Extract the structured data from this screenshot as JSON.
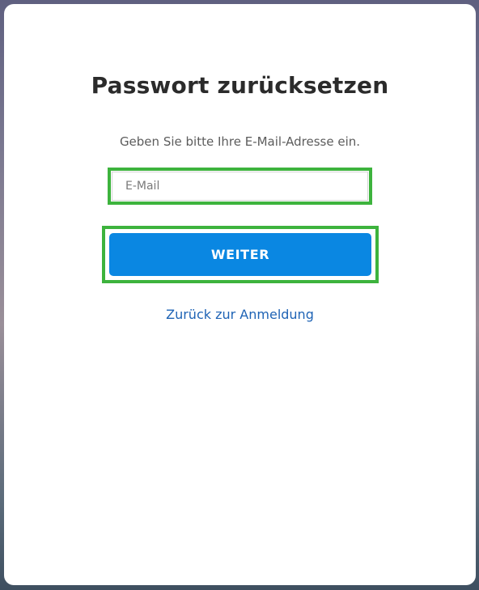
{
  "page": {
    "title": "Passwort zurücksetzen",
    "subtitle": "Geben Sie bitte Ihre E-Mail-Adresse ein."
  },
  "form": {
    "email_placeholder": "E-Mail",
    "email_value": "",
    "submit_label": "WEITER"
  },
  "links": {
    "back_label": "Zurück zur Anmeldung"
  },
  "colors": {
    "primary_button": "#0a87e2",
    "link": "#1e63b5",
    "highlight_border": "#3db33d"
  }
}
